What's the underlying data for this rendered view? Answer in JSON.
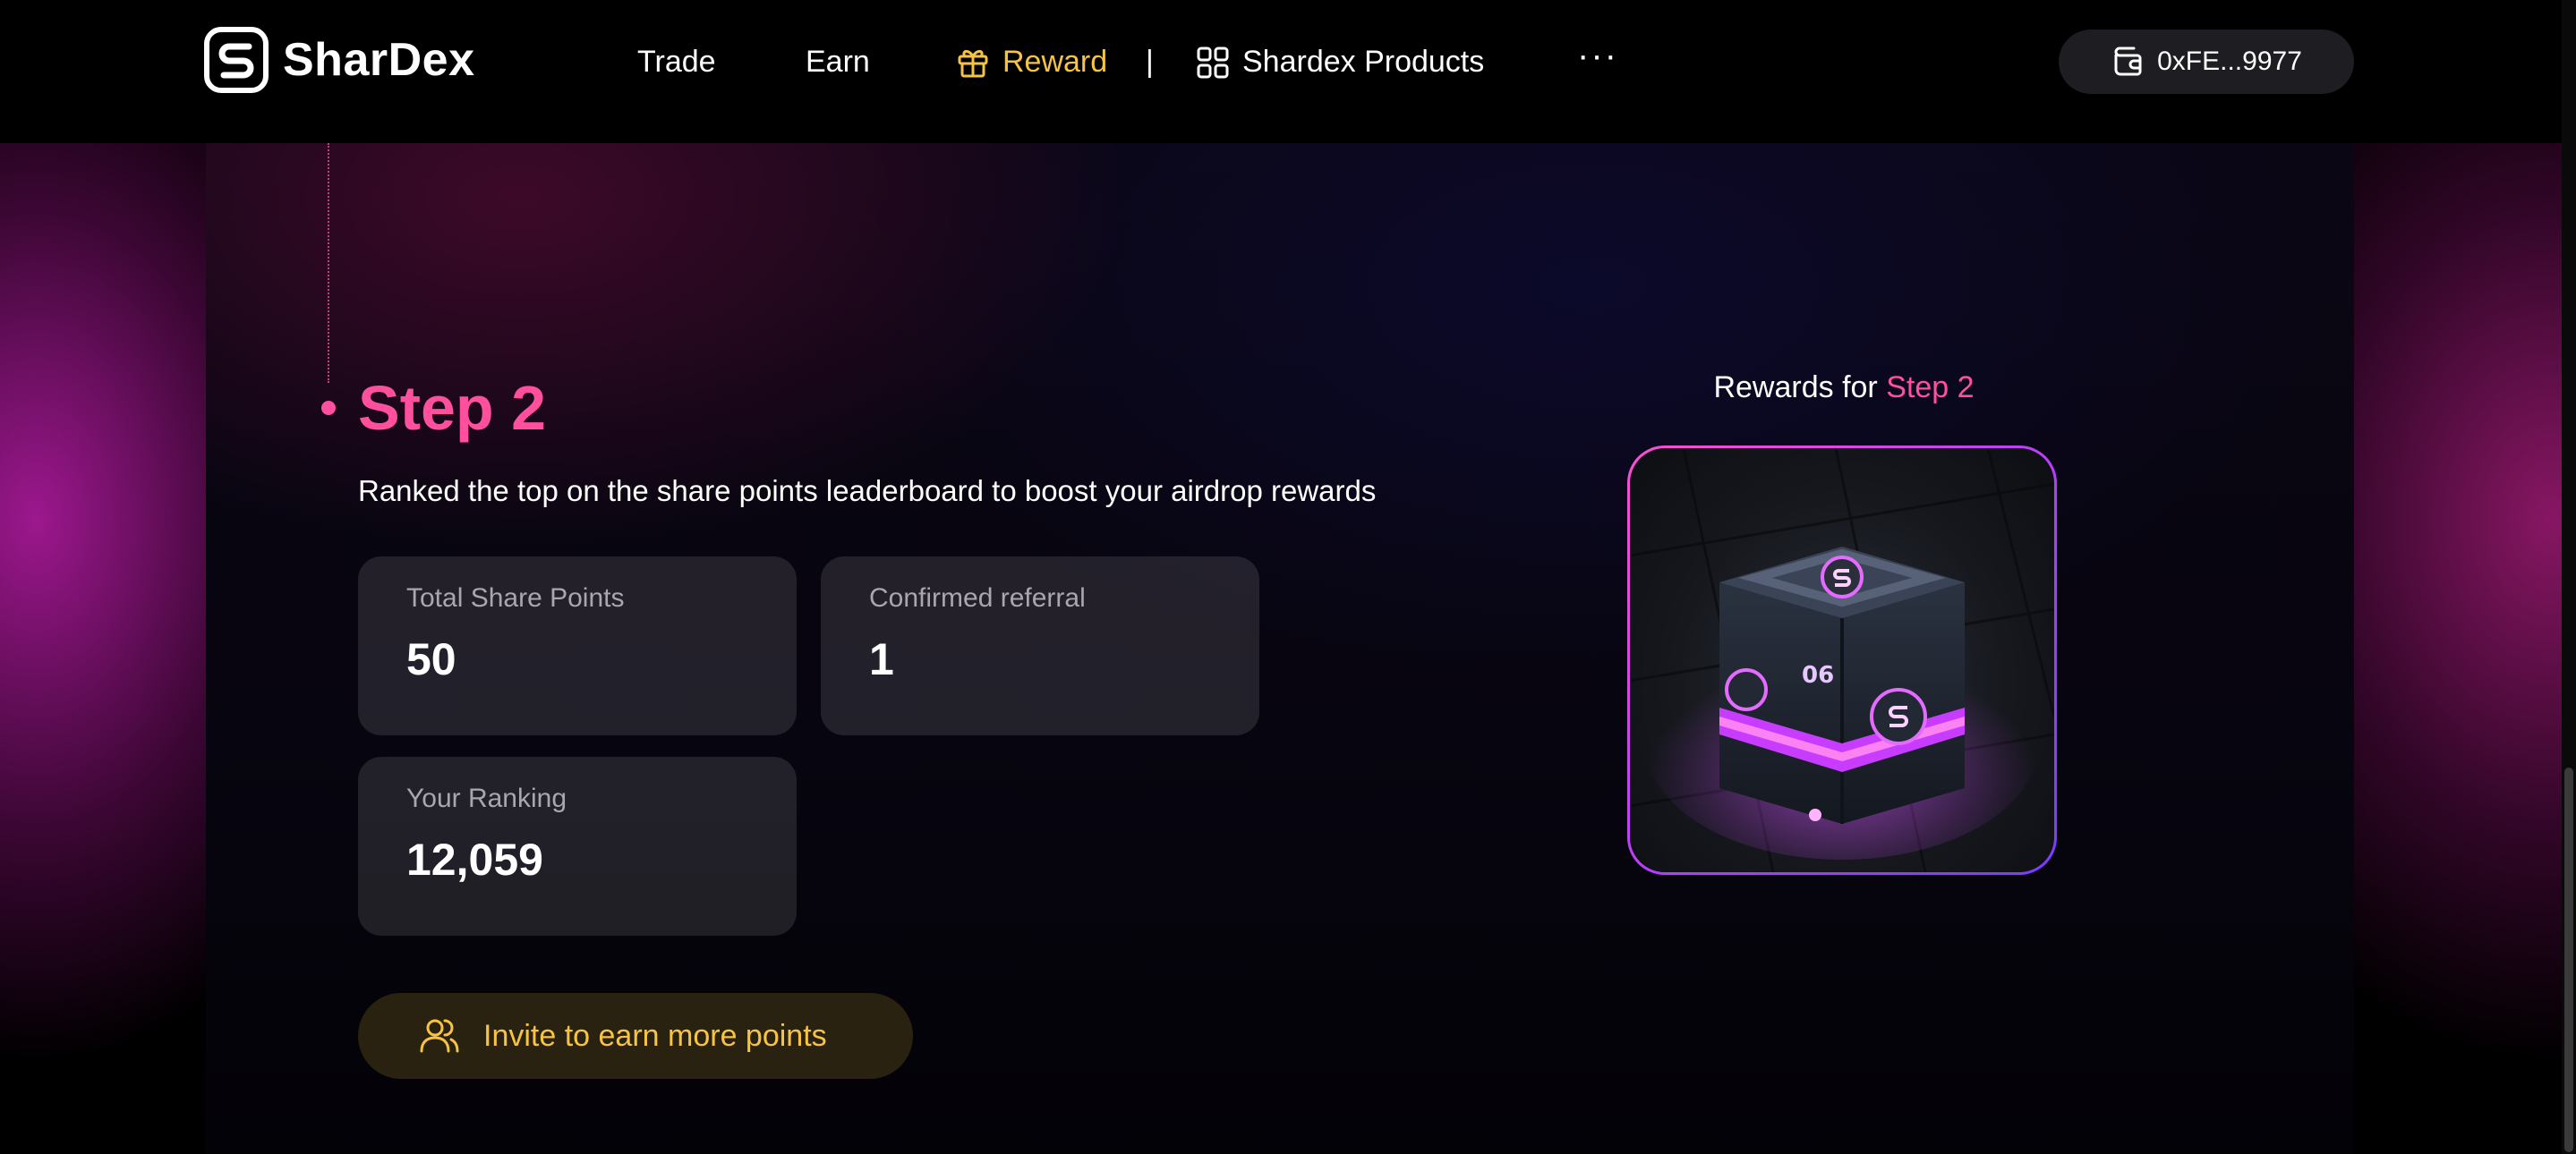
{
  "brand": {
    "name": "SharDex"
  },
  "nav": {
    "items": [
      {
        "label": "Trade"
      },
      {
        "label": "Earn"
      },
      {
        "label": "Reward",
        "active": true
      },
      {
        "label": "Shardex Products"
      }
    ],
    "separator": "|",
    "more": "···"
  },
  "wallet": {
    "address": "0xFE...9977",
    "icon": "wallet-icon"
  },
  "step": {
    "title": "Step 2",
    "description": "Ranked the top on the share points leaderboard to boost your airdrop rewards"
  },
  "stats": {
    "total_share_points": {
      "label": "Total Share Points",
      "value": "50"
    },
    "confirmed_referral": {
      "label": "Confirmed referral",
      "value": "1"
    },
    "your_ranking": {
      "label": "Your Ranking",
      "value": "12,059"
    }
  },
  "invite": {
    "label": "Invite to earn more points",
    "icon": "users-icon"
  },
  "rewards": {
    "prefix": "Rewards for ",
    "step": "Step 2"
  },
  "colors": {
    "accent_pink": "#ff4f9d",
    "accent_gold": "#f6c343",
    "background": "#000000"
  }
}
